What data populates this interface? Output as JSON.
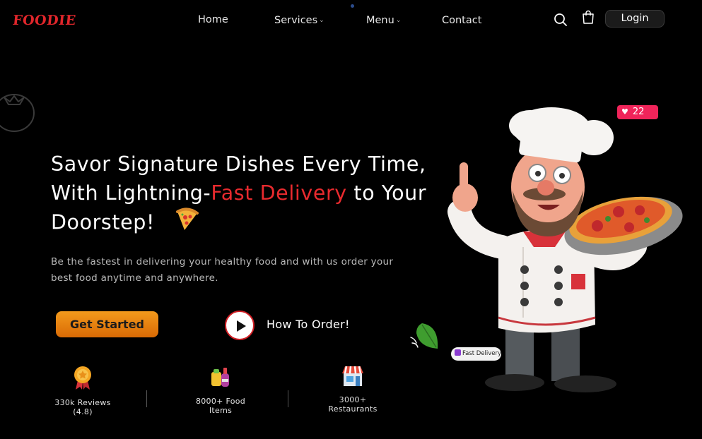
{
  "brand": {
    "logo_text": "FOODIE"
  },
  "nav": {
    "items": [
      {
        "label": "Home",
        "has_dropdown": false
      },
      {
        "label": "Services",
        "has_dropdown": true
      },
      {
        "label": "Menu",
        "has_dropdown": true
      },
      {
        "label": "Contact",
        "has_dropdown": false
      }
    ],
    "dropdown_glyph": "⌄",
    "login_label": "Login"
  },
  "icons": {
    "search": "search-icon",
    "cart": "shopping-bag-icon",
    "play": "play-icon",
    "heart": "heart-icon"
  },
  "hero": {
    "title_part1": "Savor Signature Dishes Every Time, With Lightning-",
    "title_accent": "Fast Delivery",
    "title_part2": "to Your Doorstep!",
    "subtitle": "Be the fastest in delivering your healthy food and with us order your best food anytime and anywhere.",
    "cta_label": "Get Started",
    "secondary_label": "How To Order!"
  },
  "stats": [
    {
      "line1": "330k Reviews",
      "line2": "(4.8)",
      "icon": "award-medal-icon"
    },
    {
      "line1": "8000+ Food",
      "line2": "Items",
      "icon": "food-drinks-icon"
    },
    {
      "line1": "3000+",
      "line2": "Restaurants",
      "icon": "storefront-icon"
    }
  ],
  "badges": {
    "likes_count": "22",
    "fast_delivery": "Fast Delivery"
  },
  "colors": {
    "background": "#000000",
    "accent_red": "#e82a2e",
    "cta_orange": "#e87f10",
    "likes_pink": "#f0245a"
  }
}
